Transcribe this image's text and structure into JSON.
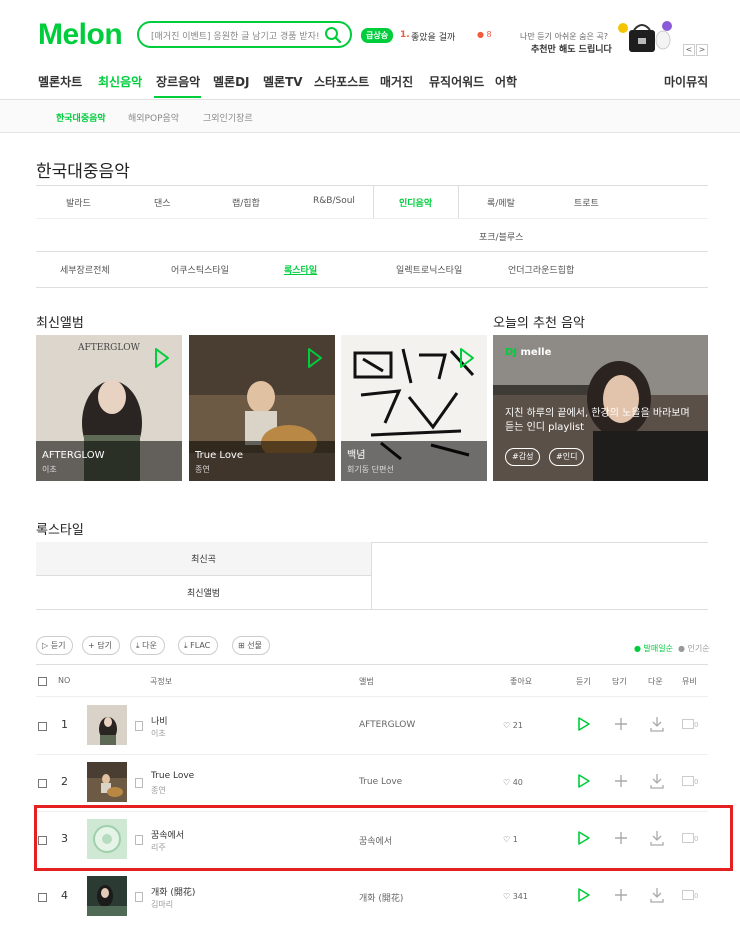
{
  "header": {
    "logo": "Melon",
    "search_placeholder": "[매거진 이벤트] 응원한 글 남기고 경품 받자!",
    "rank_badge": "급상승",
    "rank_num": "1.",
    "rank_text": "좋았을 걸까",
    "rank_dot": "● 8",
    "promo_line1": "나만 듣기 아쉬운 숨은 곡?",
    "promo_line2": "추천만 해도 드립니다",
    "prev": "<",
    "next": ">"
  },
  "gnb": [
    "멜론차트",
    "최신음악",
    "장르음악",
    "멜론DJ",
    "멜론TV",
    "스타포스트",
    "매거진",
    "뮤직어워드",
    "어학"
  ],
  "gnb_right": "마이뮤직",
  "subnav": [
    "한국대중음악",
    "해외POP음악",
    "그외인기장르"
  ],
  "page_title": "한국대중음악",
  "genres_row1": [
    "발라드",
    "댄스",
    "랩/힙합",
    "R&B/Soul",
    "인디음악",
    "록/메탈",
    "트로트"
  ],
  "genres_row2": [
    "포크/블루스"
  ],
  "styles": [
    "세부장르전체",
    "어쿠스틱스타일",
    "록스타일",
    "일렉트로닉스타일",
    "언더그라운드힙합"
  ],
  "new_albums_title": "최신앨범",
  "albums": [
    {
      "name": "AFTERGLOW",
      "artist": "이초",
      "cover_text": "AFTERGLOW"
    },
    {
      "name": "True Love",
      "artist": "종연"
    },
    {
      "name": "백념",
      "artist": "회기동 단편선"
    }
  ],
  "recommend_title": "오늘의 추천 음악",
  "recommend": {
    "dj_prefix": "DJ",
    "dj_name": "melle",
    "text": "지친 하루의 끝에서, 한강의 노을을 바라보며 듣는 인디 playlist",
    "tags": [
      "#감성",
      "#인디"
    ]
  },
  "section_title": "록스타일",
  "tabs": [
    "최신곡",
    "최신앨범"
  ],
  "tools": [
    "듣기",
    "담기",
    "다운",
    "FLAC",
    "선물"
  ],
  "sort": [
    "● 발매일순",
    "● 인기순"
  ],
  "table_headers": [
    "NO",
    "곡정보",
    "앨범",
    "좋아요",
    "듣기",
    "담기",
    "다운",
    "뮤비"
  ],
  "songs": [
    {
      "rank": "1",
      "title": "나비",
      "artist": "이초",
      "album": "AFTERGLOW",
      "likes": "21",
      "mv": "0"
    },
    {
      "rank": "2",
      "title": "True Love",
      "artist": "종연",
      "album": "True Love",
      "likes": "40",
      "mv": "0"
    },
    {
      "rank": "3",
      "title": "꿈속에서",
      "artist": "리주",
      "album": "꿈속에서",
      "likes": "1",
      "mv": "0"
    },
    {
      "rank": "4",
      "title": "개화 (開花)",
      "artist": "김마리",
      "album": "개화 (開花)",
      "likes": "341",
      "mv": "0"
    }
  ],
  "colors": {
    "brand": "#00cd3c",
    "highlight": "#e52020"
  }
}
